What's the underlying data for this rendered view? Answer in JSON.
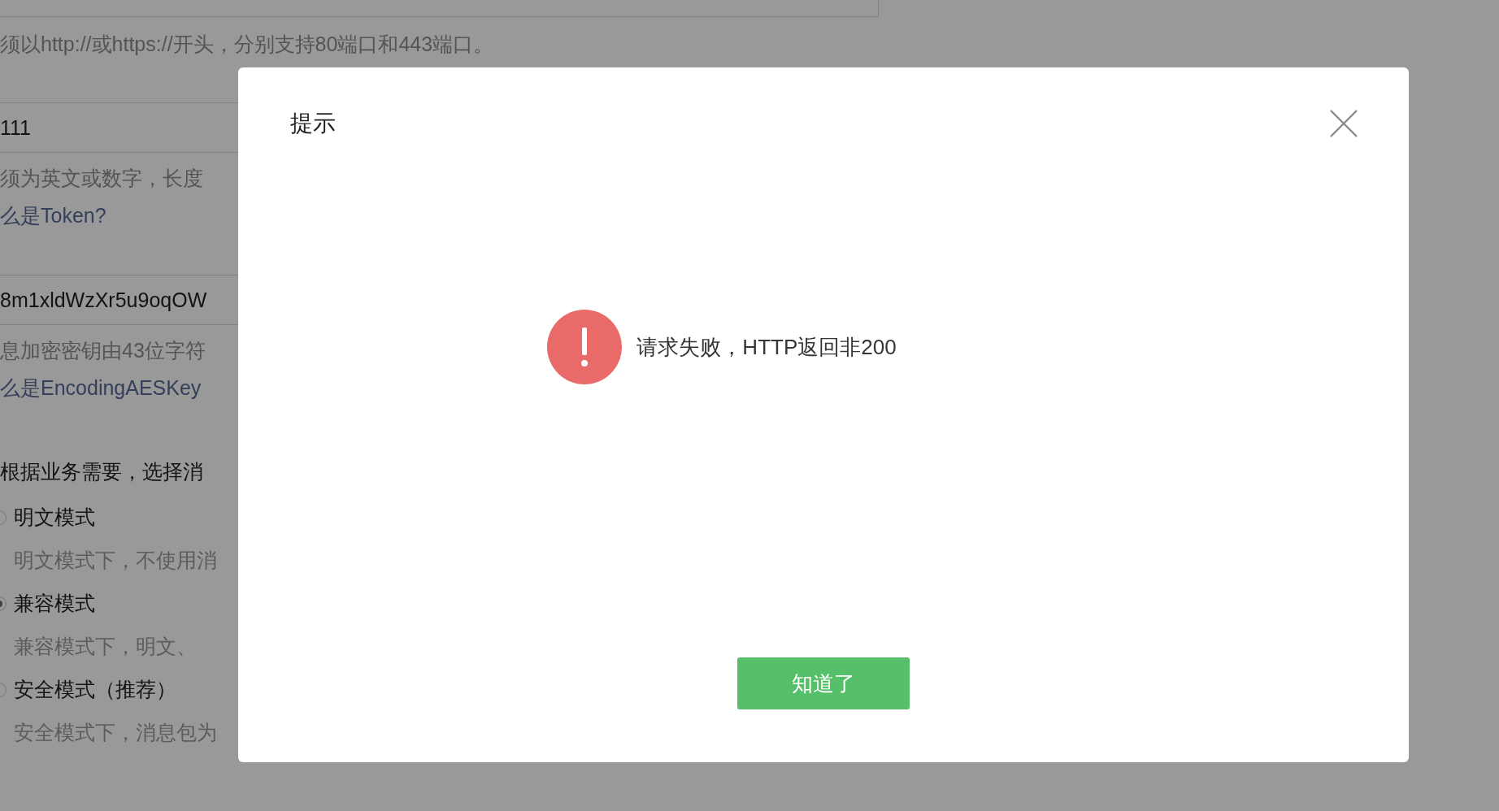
{
  "form": {
    "url_hint": "须以http://或https://开头，分别支持80端口和443端口。",
    "token_field": {
      "value": "111"
    },
    "token_hint": "须为英文或数字，长度",
    "token_link": "么是Token?",
    "aes_field": {
      "value": "8m1xldWzXr5u9oqOW"
    },
    "aes_hint": "息加密密钥由43位字符",
    "aes_link": "么是EncodingAESKey",
    "mode_prompt": "根据业务需要，选择消",
    "modes": [
      {
        "label": "明文模式",
        "description": "明文模式下，不使用消",
        "selected": false
      },
      {
        "label": "兼容模式",
        "description": "兼容模式下，明文、",
        "selected": true
      },
      {
        "label": "安全模式（推荐）",
        "description": "安全模式下，消息包为",
        "selected": false
      }
    ]
  },
  "dialog": {
    "title": "提示",
    "message": "请求失败，HTTP返回非200",
    "button": "知道了"
  }
}
